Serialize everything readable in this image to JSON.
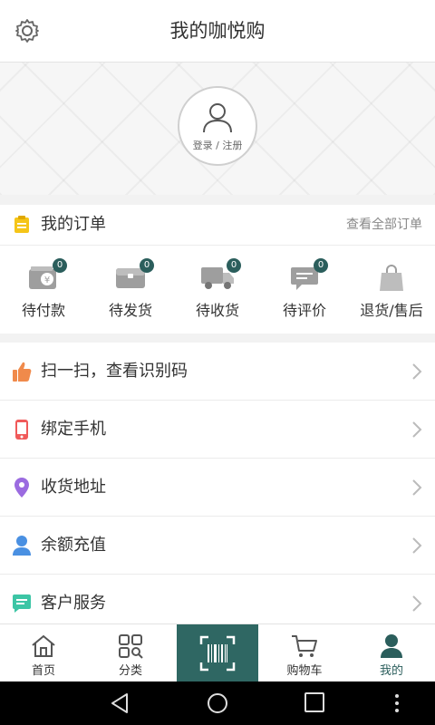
{
  "header": {
    "title": "我的咖悦购"
  },
  "profile": {
    "login_label": "登录 / 注册"
  },
  "orders": {
    "title": "我的订单",
    "view_all": "查看全部订单",
    "items": [
      {
        "label": "待付款",
        "count": "0",
        "icon": "wallet-icon"
      },
      {
        "label": "待发货",
        "count": "0",
        "icon": "package-icon"
      },
      {
        "label": "待收货",
        "count": "0",
        "icon": "truck-icon"
      },
      {
        "label": "待评价",
        "count": "0",
        "icon": "comment-icon"
      },
      {
        "label": "退货/售后",
        "icon": "shopping-bag-icon"
      }
    ]
  },
  "menu": [
    {
      "label": "扫一扫，查看识别码",
      "icon": "thumbs-up-icon",
      "color": "#f08a4b"
    },
    {
      "label": "绑定手机",
      "icon": "phone-icon",
      "color": "#f05a5a"
    },
    {
      "label": "收货地址",
      "icon": "location-pin-icon",
      "color": "#9b6be0"
    },
    {
      "label": "余额充值",
      "icon": "user-icon",
      "color": "#4a90e2"
    },
    {
      "label": "客户服务",
      "icon": "chat-icon",
      "color": "#3cc5a5"
    }
  ],
  "tabbar": {
    "items": [
      {
        "label": "首页",
        "icon": "home-icon"
      },
      {
        "label": "分类",
        "icon": "category-icon"
      },
      {
        "label": "",
        "icon": "barcode-scan-icon"
      },
      {
        "label": "购物车",
        "icon": "cart-icon"
      },
      {
        "label": "我的",
        "icon": "profile-icon"
      }
    ],
    "active_color": "#2b5e5c",
    "scan_bg": "#2f6763"
  }
}
